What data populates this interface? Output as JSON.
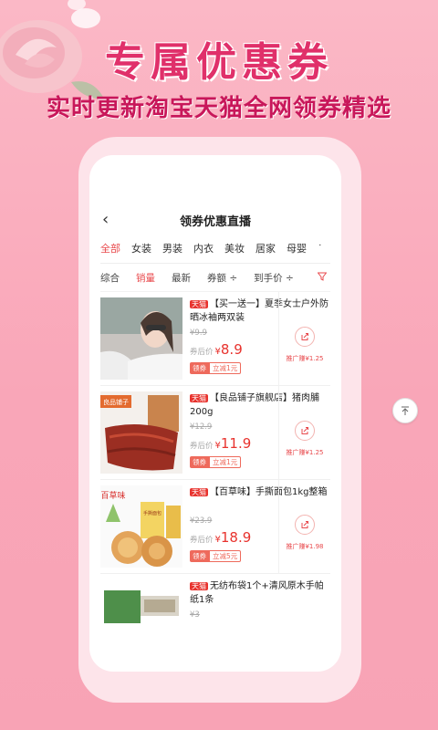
{
  "promo": {
    "title": "专属优惠券",
    "subtitle": "实时更新淘宝天猫全网领券精选"
  },
  "nav": {
    "title": "领券优惠直播"
  },
  "tabs": [
    "全部",
    "女装",
    "男装",
    "内衣",
    "美妆",
    "居家",
    "母婴",
    "˙"
  ],
  "sorts": [
    "综合",
    "销量",
    "最新",
    "券额 ÷",
    "到手价 ÷"
  ],
  "labels": {
    "after_coupon": "券后价",
    "yen": "¥",
    "coupon": "领券",
    "store_tag": "天猫"
  },
  "items": [
    {
      "title": "【买一送一】夏季女士户外防晒冰袖两双装",
      "orig": "¥9.9",
      "price": "8.9",
      "discount": "立减1元",
      "earn": "推广赚¥1.25"
    },
    {
      "title": "【良品铺子旗舰店】猪肉脯200g",
      "orig": "¥12.9",
      "price": "11.9",
      "discount": "立减1元",
      "earn": "推广赚¥1.25"
    },
    {
      "title": "【百草味】手撕面包1kg整箱",
      "orig": "¥23.9",
      "price": "18.9",
      "discount": "立减5元",
      "earn": "推广赚¥1.98"
    },
    {
      "title": "无纺布袋1个+清风原木手帕纸1条",
      "orig": "¥3"
    }
  ],
  "thumb_text": {
    "brand1": "良品铺子",
    "brand2": "百草味",
    "bread": "手撕面包"
  },
  "colors": {
    "accent": "#e8494c",
    "title_pink": "#e0306a",
    "bg_pink": "#f9a6b8"
  }
}
